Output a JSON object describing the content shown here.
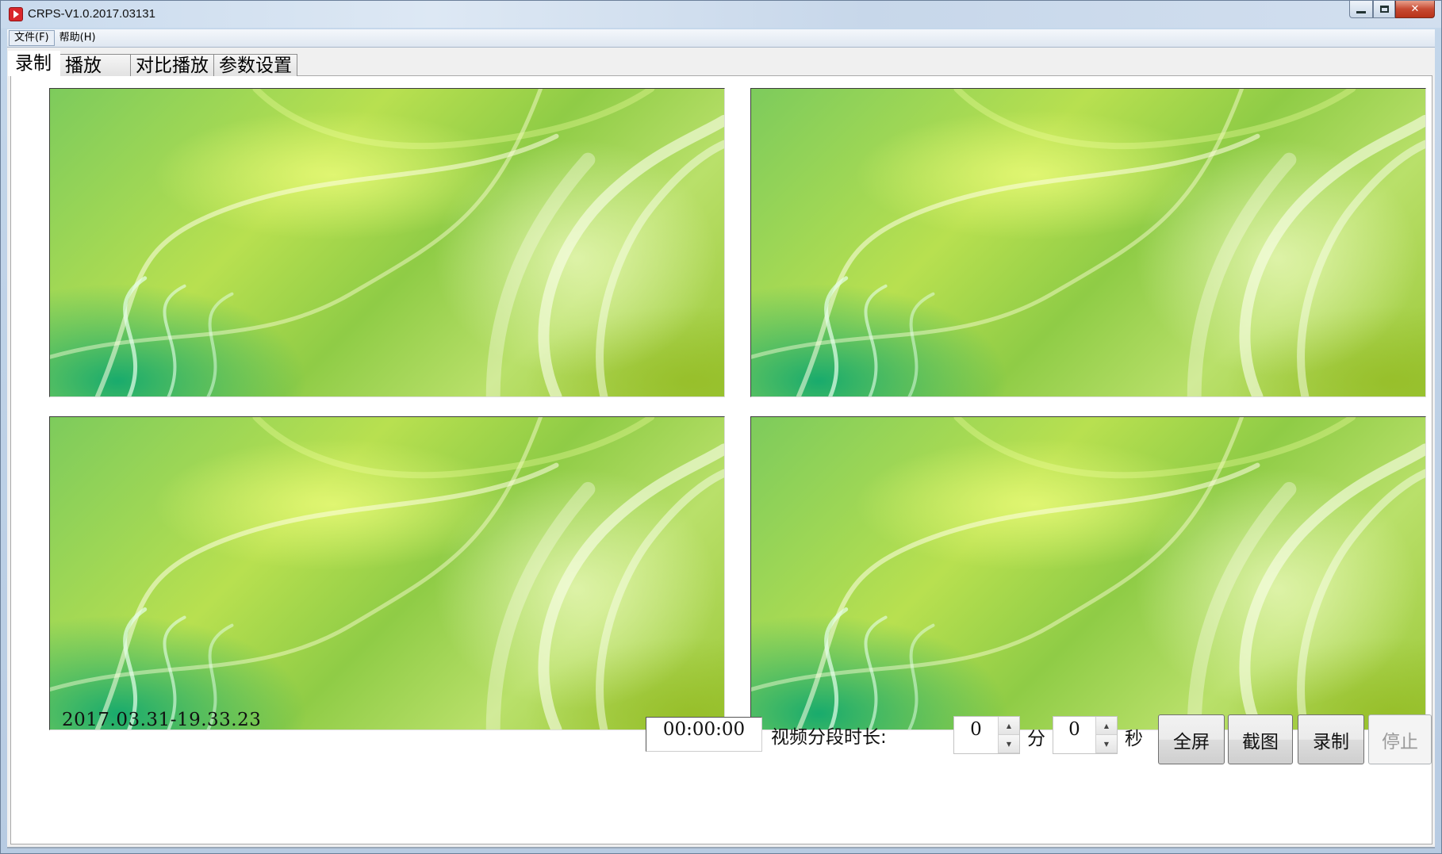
{
  "window": {
    "title": "CRPS-V1.0.2017.03131"
  },
  "menu": {
    "items": [
      "文件(F)",
      "帮助(H)"
    ]
  },
  "tabs": [
    "录制",
    "播放",
    "对比播放",
    "参数设置"
  ],
  "status": {
    "timestamp": "2017.03.31-19.33.23"
  },
  "controls": {
    "timer": "00:00:00",
    "segment_label": "视频分段时长:",
    "minutes": "0",
    "minutes_unit": "分",
    "seconds": "0",
    "seconds_unit": "秒",
    "spin_up": "▲",
    "spin_down": "▼"
  },
  "buttons": {
    "fullscreen": "全屏",
    "screenshot": "截图",
    "record": "录制",
    "stop": "停止"
  },
  "icons": {
    "app": "app-icon",
    "minimize": "minimize-icon",
    "maximize": "maximize-icon",
    "close": "close-icon"
  }
}
